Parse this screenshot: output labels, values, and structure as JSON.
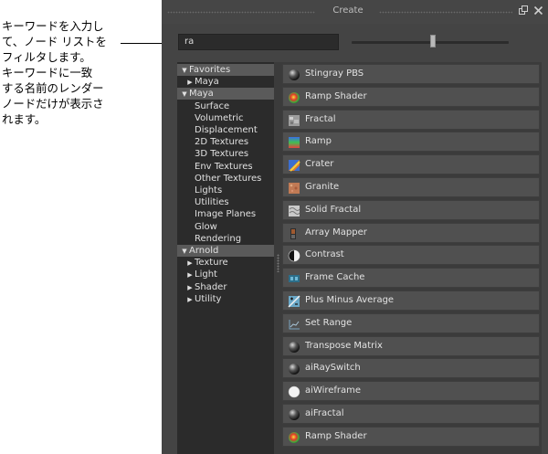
{
  "annotation": {
    "text": "キーワードを入力し\nて、ノード リストを\nフィルタします。\nキーワードに一致\nする名前のレンダー\nノードだけが表示さ\nれます。"
  },
  "window": {
    "title": "Create",
    "buttons": [
      "float",
      "close"
    ]
  },
  "search": {
    "value": "ra"
  },
  "icon_size_slider": {
    "value_fraction": 0.52
  },
  "tree": {
    "items": [
      {
        "label": "Favorites",
        "state": "expanded",
        "level": 0,
        "highlight": true
      },
      {
        "label": "Maya",
        "state": "collapsed",
        "level": 1,
        "highlight": false
      },
      {
        "label": "Maya",
        "state": "expanded",
        "level": 0,
        "highlight": true
      },
      {
        "label": "Surface",
        "state": "leaf",
        "level": 1,
        "highlight": false
      },
      {
        "label": "Volumetric",
        "state": "leaf",
        "level": 1,
        "highlight": false
      },
      {
        "label": "Displacement",
        "state": "leaf",
        "level": 1,
        "highlight": false
      },
      {
        "label": "2D Textures",
        "state": "leaf",
        "level": 1,
        "highlight": false
      },
      {
        "label": "3D Textures",
        "state": "leaf",
        "level": 1,
        "highlight": false
      },
      {
        "label": "Env Textures",
        "state": "leaf",
        "level": 1,
        "highlight": false
      },
      {
        "label": "Other Textures",
        "state": "leaf",
        "level": 1,
        "highlight": false
      },
      {
        "label": "Lights",
        "state": "leaf",
        "level": 1,
        "highlight": false
      },
      {
        "label": "Utilities",
        "state": "leaf",
        "level": 1,
        "highlight": false
      },
      {
        "label": "Image Planes",
        "state": "leaf",
        "level": 1,
        "highlight": false
      },
      {
        "label": "Glow",
        "state": "leaf",
        "level": 1,
        "highlight": false
      },
      {
        "label": "Rendering",
        "state": "leaf",
        "level": 1,
        "highlight": false
      },
      {
        "label": "Arnold",
        "state": "expanded",
        "level": 0,
        "highlight": true
      },
      {
        "label": "Texture",
        "state": "collapsed",
        "level": 1,
        "highlight": false
      },
      {
        "label": "Light",
        "state": "collapsed",
        "level": 1,
        "highlight": false
      },
      {
        "label": "Shader",
        "state": "collapsed",
        "level": 1,
        "highlight": false
      },
      {
        "label": "Utility",
        "state": "collapsed",
        "level": 1,
        "highlight": false
      }
    ]
  },
  "nodes": [
    {
      "label": "Stingray PBS",
      "icon": "sphere-dark-icon"
    },
    {
      "label": "Ramp Shader",
      "icon": "ramp-shader-icon"
    },
    {
      "label": "Fractal",
      "icon": "fractal-icon"
    },
    {
      "label": "Ramp",
      "icon": "ramp-gradient-icon"
    },
    {
      "label": "Crater",
      "icon": "crater-icon"
    },
    {
      "label": "Granite",
      "icon": "granite-icon"
    },
    {
      "label": "Solid Fractal",
      "icon": "solid-fractal-icon"
    },
    {
      "label": "Array Mapper",
      "icon": "array-mapper-icon"
    },
    {
      "label": "Contrast",
      "icon": "contrast-icon"
    },
    {
      "label": "Frame Cache",
      "icon": "frame-cache-icon"
    },
    {
      "label": "Plus Minus Average",
      "icon": "plus-minus-average-icon"
    },
    {
      "label": "Set Range",
      "icon": "set-range-icon"
    },
    {
      "label": "Transpose Matrix",
      "icon": "sphere-dark-icon"
    },
    {
      "label": "aiRaySwitch",
      "icon": "sphere-dark-icon"
    },
    {
      "label": "aiWireframe",
      "icon": "sphere-white-icon"
    },
    {
      "label": "aiFractal",
      "icon": "sphere-dark-icon"
    },
    {
      "label": "Ramp Shader",
      "icon": "ramp-shader-icon"
    }
  ]
}
